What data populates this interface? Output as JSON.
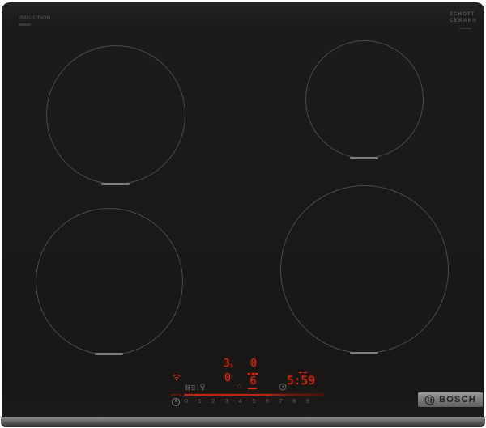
{
  "branding": {
    "surface_type_label": "INDUCTION",
    "glass_brand_line1": "SCHOTT",
    "glass_brand_line2": "CERAN®",
    "manufacturer": "BOSCH"
  },
  "control_panel": {
    "power_levels": {
      "back_left": "3",
      "back_left_suffix": "s",
      "back_right": "0",
      "front_left": "0",
      "front_right": "6"
    },
    "timer_display": "5:59",
    "slider": {
      "digits": [
        "0",
        "1",
        "2",
        "3",
        "4",
        "5",
        "6",
        "7",
        "8",
        "9"
      ],
      "separator": "·"
    },
    "icons": {
      "wifi": "home-connect-wifi-indicator",
      "pause": "pause-key",
      "key": "child-lock-key",
      "star": "star-indicator",
      "star_glyph": "☆",
      "clock": "timer-clock",
      "power": "main-power-standby"
    }
  },
  "colors": {
    "display_red": "#de2a18",
    "glass_black": "#1a1918",
    "zone_outline_grey": "#4a4a48",
    "label_grey": "#585856"
  }
}
